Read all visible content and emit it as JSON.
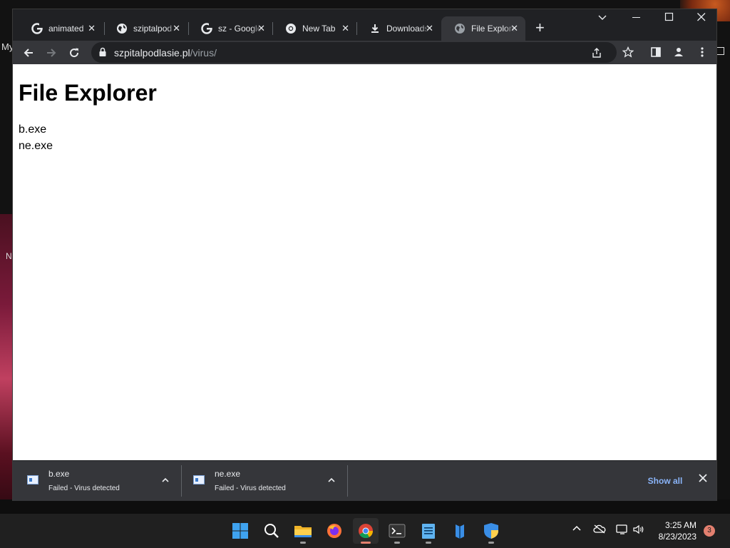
{
  "desktop": {
    "label_my": "My",
    "label_n": "N"
  },
  "browser": {
    "tabs": [
      {
        "title": "animated",
        "icon": "google-icon",
        "active": false
      },
      {
        "title": "sziptalpod",
        "icon": "globe-icon",
        "active": false
      },
      {
        "title": "sz - Google",
        "icon": "google-icon",
        "active": false
      },
      {
        "title": "New Tab",
        "icon": "chrome-icon",
        "active": false
      },
      {
        "title": "Downloads",
        "icon": "download-icon",
        "active": false
      },
      {
        "title": "File Explorer",
        "icon": "globe-icon",
        "active": true
      }
    ],
    "address": {
      "host": "szpitalpodlasie.pl",
      "path": "/virus/"
    }
  },
  "page": {
    "heading": "File Explorer",
    "files": [
      "b.exe",
      "ne.exe"
    ]
  },
  "downloads": {
    "items": [
      {
        "name": "b.exe",
        "status": "Failed - Virus detected"
      },
      {
        "name": "ne.exe",
        "status": "Failed - Virus detected"
      }
    ],
    "show_all_label": "Show all"
  },
  "taskbar": {
    "time": "3:25 AM",
    "date": "8/23/2023",
    "notification_count": "3",
    "apps": [
      "windows-start",
      "search",
      "file-explorer",
      "firefox",
      "chrome",
      "terminal",
      "notepad",
      "app",
      "windows-security"
    ]
  }
}
